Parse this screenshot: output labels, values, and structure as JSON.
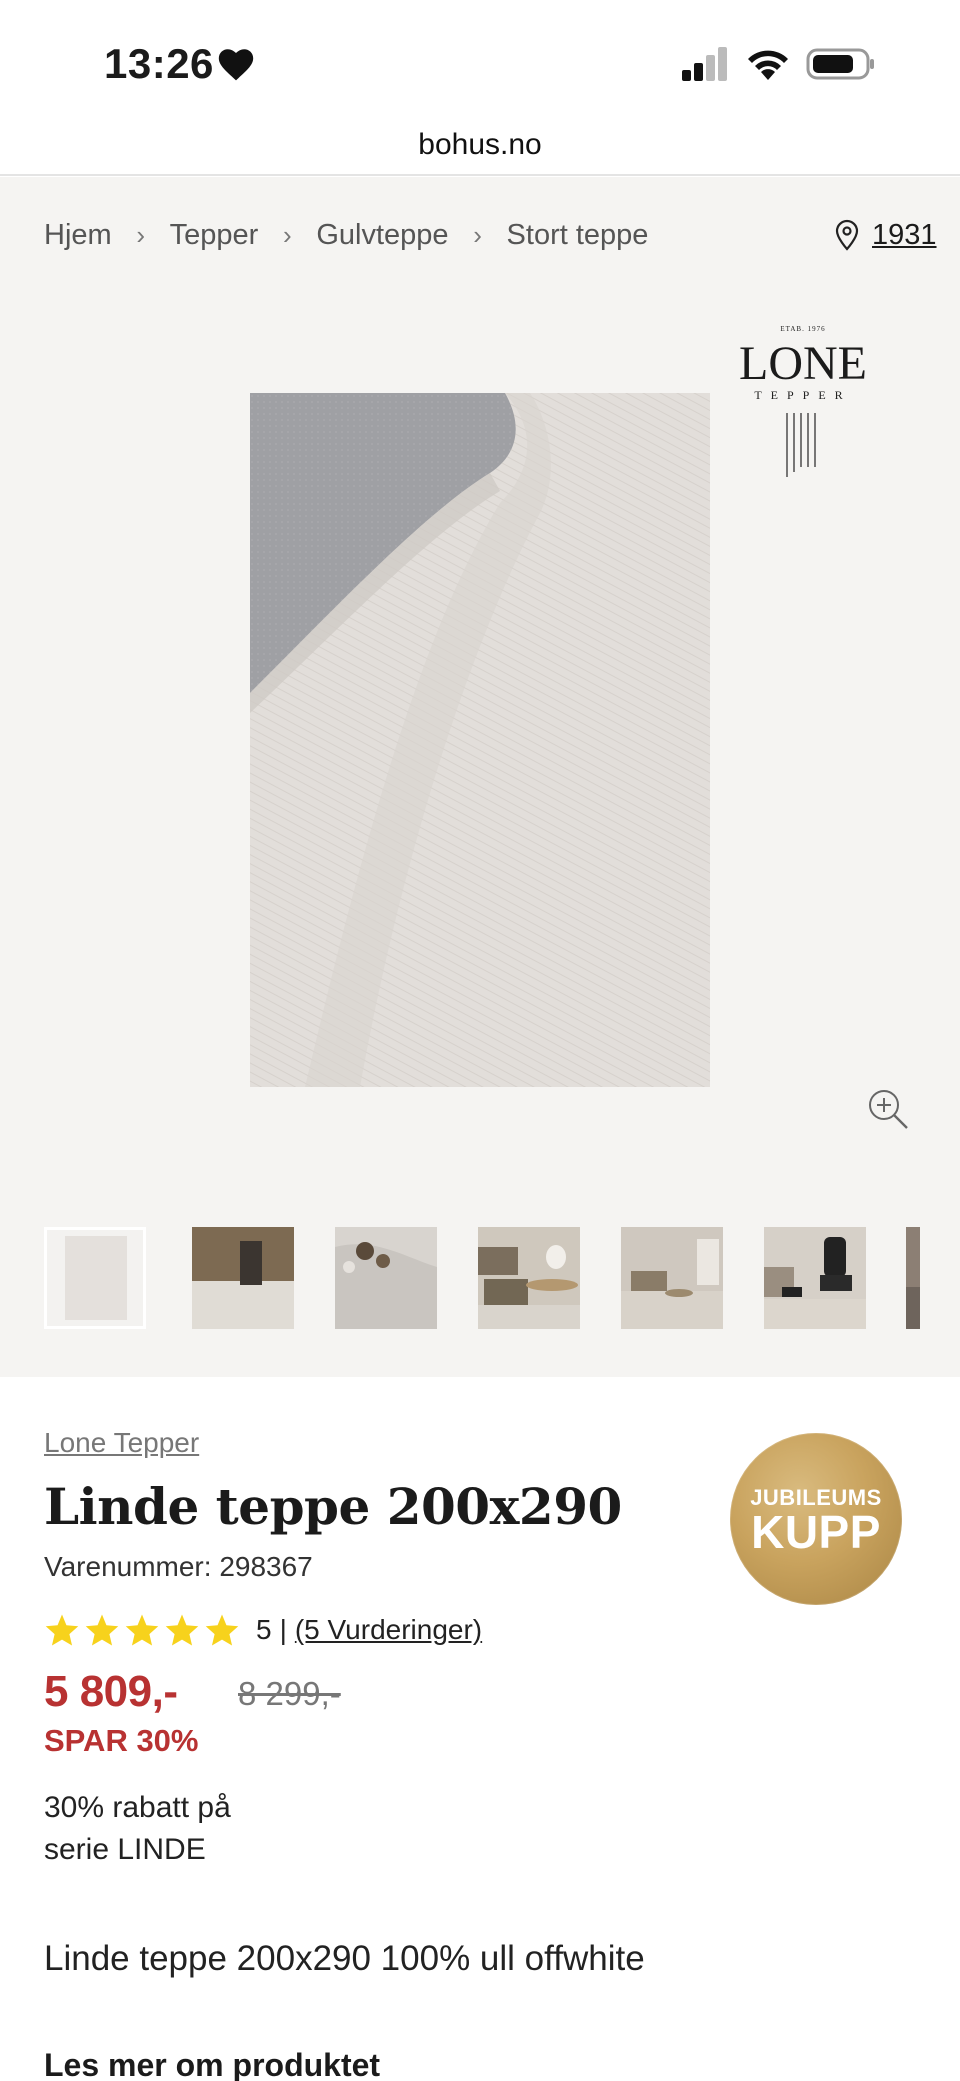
{
  "status_bar": {
    "time": "13:26"
  },
  "browser": {
    "url": "bohus.no"
  },
  "breadcrumb": [
    "Hjem",
    "Tepper",
    "Gulvteppe",
    "Stort teppe"
  ],
  "store": {
    "label": "1931"
  },
  "brand_logo": {
    "etab": "ETAB. 1976",
    "name": "LONE",
    "sub": "TEPPER"
  },
  "thumbnails": [
    "rug-flat-product",
    "rug-with-side-table",
    "rug-closeup-with-flowers",
    "living-room-sofa-ottoman",
    "living-room-wide",
    "living-room-armchair",
    "room-partial"
  ],
  "product": {
    "brand": "Lone Tepper",
    "title": "Linde teppe 200x290",
    "sku": "Varenummer: 298367",
    "rating": {
      "stars": 5,
      "score": "5",
      "separator": "|",
      "reviews": "(5 Vurderinger)"
    },
    "price": "5 809,-",
    "old_price": "8 299,-",
    "save": "SPAR 30%",
    "campaign_line1": "30% rabatt på",
    "campaign_line2": "serie LINDE",
    "description": "Linde teppe 200x290 100% ull offwhite",
    "read_more": "Les mer om produktet"
  },
  "badge": {
    "line1": "JUBILEUMS",
    "line2": "KUPP"
  },
  "colors": {
    "sale_red": "#b83232",
    "gallery_bg": "#f5f4f2",
    "badge_gold": "#c9a35e",
    "star_yellow": "#f7d21c"
  }
}
